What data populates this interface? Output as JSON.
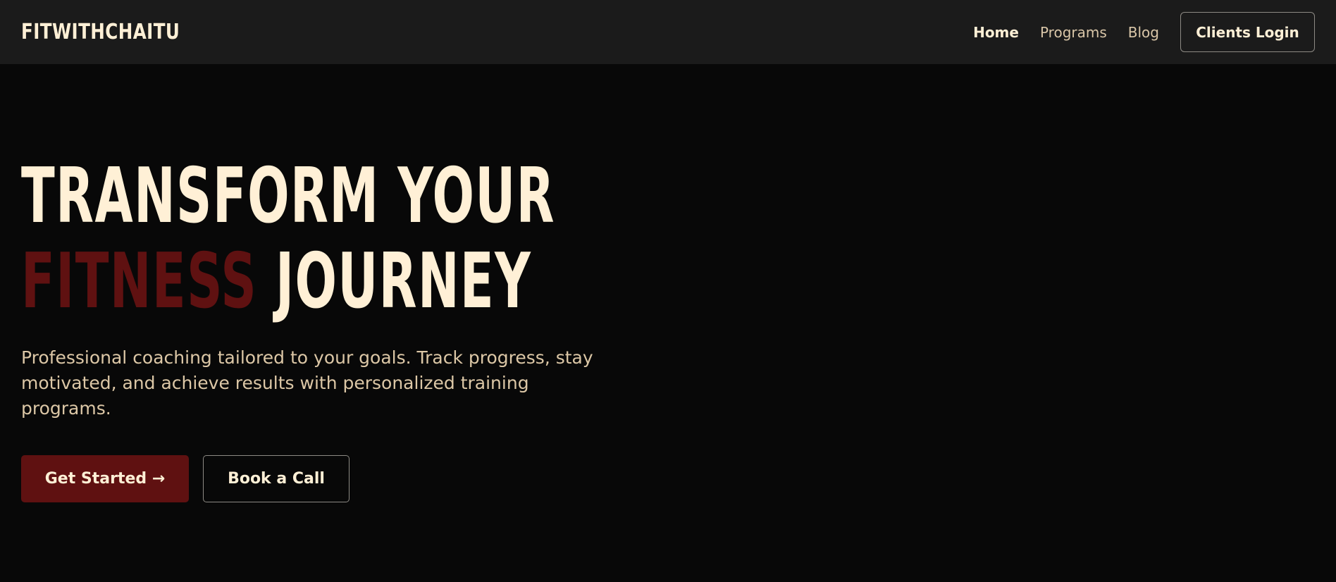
{
  "header": {
    "brand": "FITWITHCHAITU",
    "nav": [
      {
        "label": "Home",
        "active": true
      },
      {
        "label": "Programs",
        "active": false
      },
      {
        "label": "Blog",
        "active": false
      }
    ],
    "login_label": "Clients Login"
  },
  "hero": {
    "headline_line1": "TRANSFORM YOUR",
    "headline_accent": "FITNESS",
    "headline_line2_rest": "JOURNEY",
    "subtext": "Professional coaching tailored to your goals. Track progress, stay motivated, and achieve results with personalized training programs.",
    "primary_cta": "Get Started →",
    "secondary_cta": "Book a Call"
  },
  "colors": {
    "background": "#080808",
    "header_background": "#1b1b1b",
    "cream": "#fff0d6",
    "accent_red": "#5f1111",
    "muted_text": "#dcc7a6",
    "border_gray": "#8d8a84"
  }
}
